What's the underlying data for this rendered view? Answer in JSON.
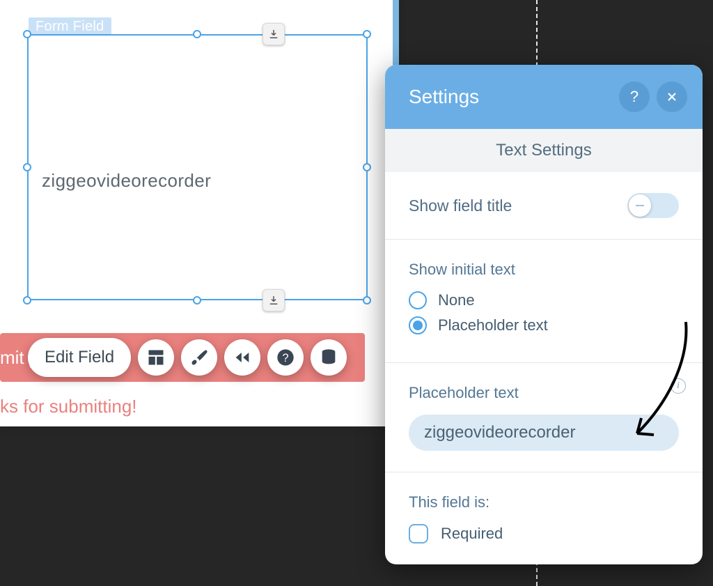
{
  "editor": {
    "selection_label": "Form Field",
    "placeholder_value": "ziggeovideorecorder",
    "submit_label_fragment": "mit y",
    "thanks_fragment": "ks for submitting!",
    "toolbar": {
      "edit_field": "Edit Field",
      "icons": [
        "layout-icon",
        "brush-icon",
        "rewind-icon",
        "help-icon",
        "database-icon"
      ]
    }
  },
  "panel": {
    "title": "Settings",
    "subtitle": "Text Settings",
    "sections": {
      "show_field_title": {
        "label": "Show field title",
        "value": false
      },
      "initial_text": {
        "label": "Show initial text",
        "options": [
          "None",
          "Placeholder text"
        ],
        "selected": "Placeholder text"
      },
      "placeholder": {
        "label": "Placeholder text",
        "value": "ziggeovideorecorder"
      },
      "required": {
        "label": "This field is:",
        "option": "Required",
        "checked": false
      }
    }
  }
}
